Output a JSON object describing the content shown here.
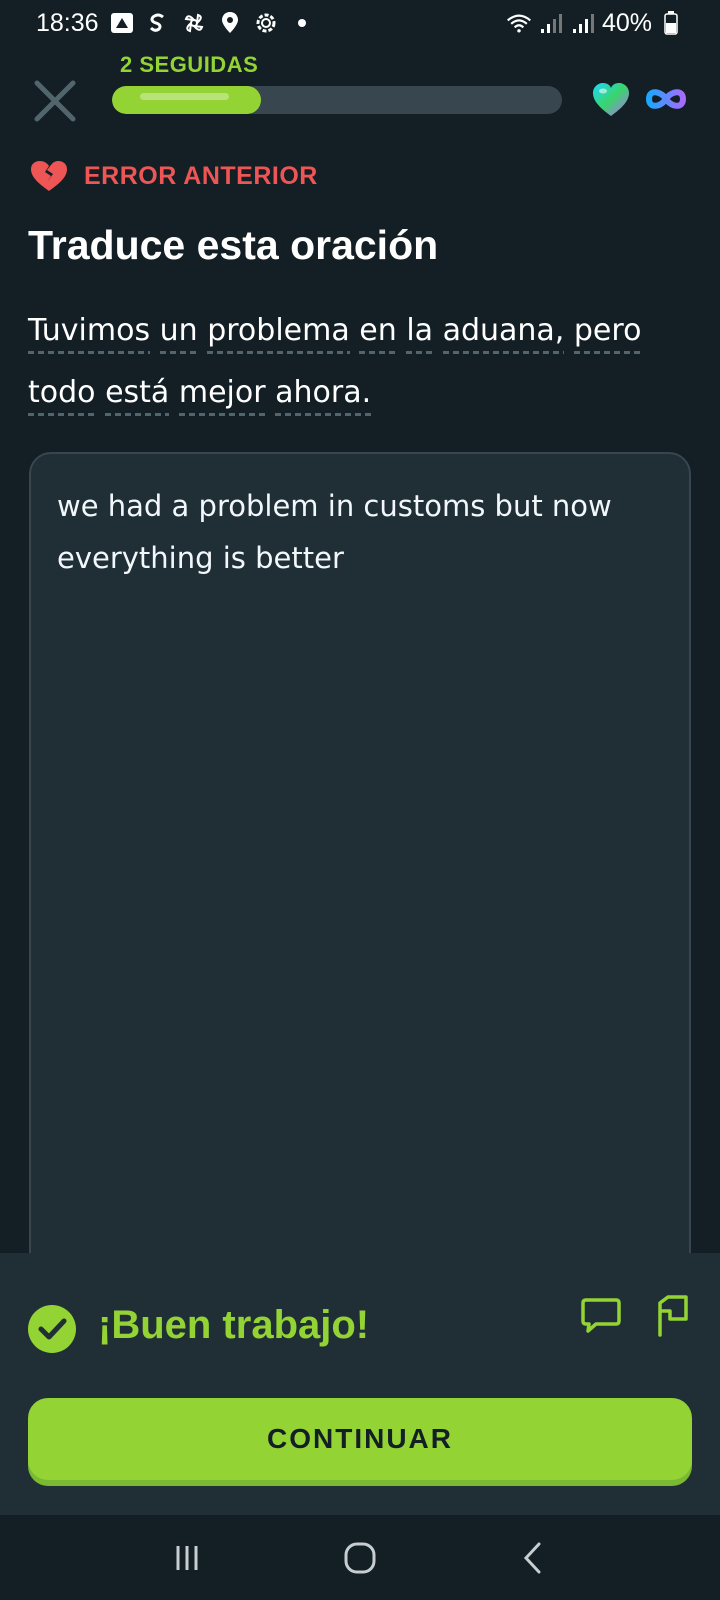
{
  "status_bar": {
    "time": "18:36",
    "battery": "40%"
  },
  "top_bar": {
    "streak_label": "2 SEGUIDAS",
    "progress": 0.33
  },
  "previous_error": {
    "label": "ERROR ANTERIOR"
  },
  "title": "Traduce esta oración",
  "prompt": {
    "line1_words": [
      "Tuvimos",
      "un",
      "problema",
      "en",
      "la",
      "aduana,",
      "pero"
    ],
    "line2_words": [
      "todo",
      "está",
      "mejor",
      "ahora."
    ]
  },
  "answer": {
    "value": "we had a problem in customs but now everything is better"
  },
  "feedback": {
    "title": "¡Buen trabajo!",
    "continue_label": "CONTINUAR"
  },
  "colors": {
    "background": "#131f24",
    "accent_green": "#93d334",
    "error_red": "#ee5555",
    "panel": "#202f36"
  }
}
